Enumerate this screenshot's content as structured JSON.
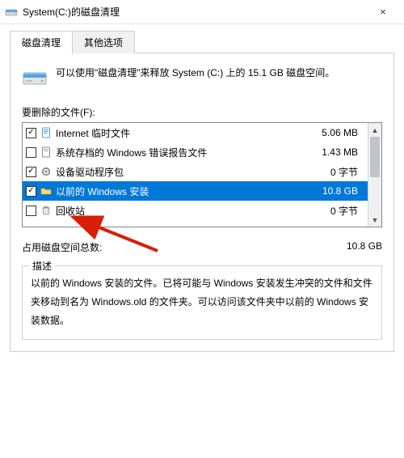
{
  "window": {
    "title": "System(C:)的磁盘清理",
    "close_icon": "×"
  },
  "tabs": {
    "active": "磁盘清理",
    "inactive": "其他选项"
  },
  "intro": "可以使用\"磁盘清理\"来释放 System (C:) 上的 15.1 GB 磁盘空间。",
  "files_label": "要删除的文件(F):",
  "items": [
    {
      "checked": true,
      "icon": "page",
      "label": "Internet 临时文件",
      "size": "5.06 MB"
    },
    {
      "checked": false,
      "icon": "page",
      "label": "系统存档的 Windows 错误报告文件",
      "size": "1.43 MB"
    },
    {
      "checked": true,
      "icon": "gear",
      "label": "设备驱动程序包",
      "size": "0 字节"
    },
    {
      "checked": true,
      "icon": "folder",
      "label": "以前的 Windows 安装",
      "size": "10.8 GB",
      "selected": true
    },
    {
      "checked": false,
      "icon": "bin",
      "label": "回收站",
      "size": "0 字节"
    }
  ],
  "total": {
    "label": "占用磁盘空间总数:",
    "value": "10.8 GB"
  },
  "description": {
    "title": "描述",
    "body": "以前的 Windows 安装的文件。已将可能与 Windows 安装发生冲突的文件和文件夹移动到名为 Windows.old 的文件夹。可以访问该文件夹中以前的 Windows 安装数据。"
  }
}
